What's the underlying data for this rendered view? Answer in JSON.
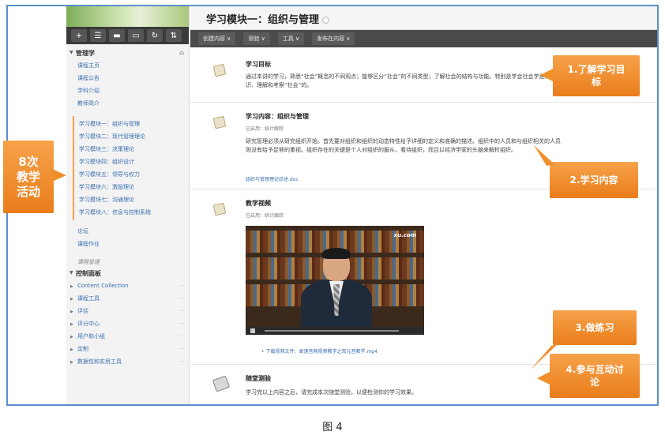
{
  "page_title": "学习模块一：组织与管理",
  "menu": [
    "创建内容 ∨",
    "测验 ∨",
    "工具 ∨",
    "发布在内容 ∨"
  ],
  "toolbar_icons": [
    "plus-icon",
    "list-icon",
    "folder-icon",
    "monitor-icon",
    "refresh-icon",
    "sort-icon"
  ],
  "toolbar_glyphs": [
    "+",
    "☰",
    "▬",
    "▭",
    "↻",
    "⇅"
  ],
  "sidebar": {
    "course_title": "管理学",
    "course_items": [
      "课程主页",
      "课程公告",
      "学科介绍",
      "教师简介"
    ],
    "modules": [
      "学习模块一：组织与管理",
      "学习模块二：现代管理理论",
      "学习模块三：决策理论",
      "学习模块四：组织设计",
      "学习模块五：领导与权力",
      "学习模块六：激励理论",
      "学习模块七：沟通理论",
      "学习模块八：信息与控制系统"
    ],
    "extra_items": [
      "论坛",
      "课程作业"
    ],
    "management_title": "课程管理",
    "control_panel_title": "控制面板",
    "control_items": [
      "Content Collection",
      "课程工具",
      "评估",
      "评分中心",
      "用户和小组",
      "定制",
      "数据包和实用工具"
    ]
  },
  "items": [
    {
      "title": "学习目标",
      "text": "通过本讲的学习，熟悉“社会”概念的不同观点；能够区分“社会”的不同类型；了解社会的结构与功能。特别是学会社会学是如何认识、理解和考察“社会”的。"
    },
    {
      "title": "学习内容：组织与管理",
      "meta": "已启用：统计跟踪",
      "text": "研究管理必须从研究组织开始。首先要对组织和组织的动态特性给予详细的定义和准确的描述。组织中的人员和与组织相关的人员则没有给予足够的重视。组织存在的关键是个人对组织的服从，看待组织，而且以经济学家的头脑来解析组织。",
      "link": "组织与管理理论综述.doc"
    },
    {
      "title": "教学视频",
      "meta": "已启用：统计跟踪",
      "video_logo": "xu.com",
      "download": "• 下载视频文件：高速音频视频教学之双元音教学.mp4"
    },
    {
      "title": "随堂测验",
      "text": "学习完以上内容之后，请完成本次随堂测验，以便检测你的学习效果。"
    }
  ],
  "callouts": {
    "left": "8次\n教学\n活动",
    "c1": "1.了解学习目\n标",
    "c2": "2.学习内容",
    "c3": "3.做练习",
    "c4": "4.参与互动讨\n论"
  },
  "caption": "图 4"
}
